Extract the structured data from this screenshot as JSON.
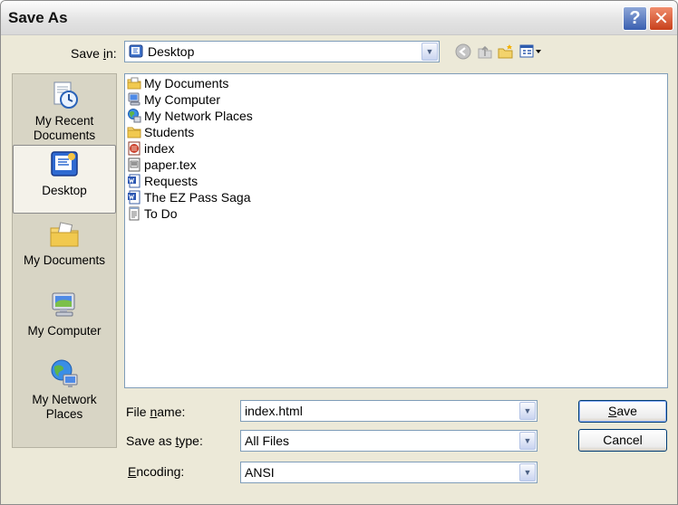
{
  "window": {
    "title": "Save As"
  },
  "titlebar": {
    "help_glyph": "?",
    "close_glyph": "✕"
  },
  "top": {
    "save_in_label_prefix": "Save ",
    "save_in_label_u": "i",
    "save_in_label_suffix": "n:",
    "save_in_value": "Desktop",
    "icons": [
      "back-icon",
      "up-folder-icon",
      "new-folder-icon",
      "view-menu-icon"
    ]
  },
  "places": [
    {
      "id": "recent",
      "label_line1": "My Recent",
      "label_line2": "Documents",
      "icon": "recent-documents-icon"
    },
    {
      "id": "desktop",
      "label_line1": "Desktop",
      "label_line2": "",
      "icon": "desktop-icon",
      "selected": true
    },
    {
      "id": "documents",
      "label_line1": "My Documents",
      "label_line2": "",
      "icon": "my-documents-icon"
    },
    {
      "id": "computer",
      "label_line1": "My Computer",
      "label_line2": "",
      "icon": "my-computer-icon"
    },
    {
      "id": "network",
      "label_line1": "My Network",
      "label_line2": "Places",
      "icon": "my-network-icon"
    }
  ],
  "files": [
    {
      "name": "My Documents",
      "icon": "my-documents-icon"
    },
    {
      "name": "My Computer",
      "icon": "my-computer-icon"
    },
    {
      "name": "My Network Places",
      "icon": "my-network-icon"
    },
    {
      "name": "Students",
      "icon": "folder-icon"
    },
    {
      "name": "index",
      "icon": "html-file-icon"
    },
    {
      "name": "paper.tex",
      "icon": "tex-file-icon"
    },
    {
      "name": "Requests",
      "icon": "word-document-icon"
    },
    {
      "name": "The EZ Pass Saga",
      "icon": "word-document-icon"
    },
    {
      "name": "To Do",
      "icon": "text-file-icon"
    }
  ],
  "form": {
    "file_name_label_prefix": "File ",
    "file_name_label_u": "n",
    "file_name_label_suffix": "ame:",
    "file_name_value": "index.html",
    "save_type_label_prefix": "Save as ",
    "save_type_label_u": "t",
    "save_type_label_suffix": "ype:",
    "save_type_value": "All Files",
    "encoding_label_prefix": "",
    "encoding_label_u": "E",
    "encoding_label_suffix": "ncoding:",
    "encoding_value": "ANSI"
  },
  "buttons": {
    "save_u": "S",
    "save_rest": "ave",
    "cancel": "Cancel"
  },
  "colors": {
    "dialog_bg": "#ece9d8",
    "accent_border": "#7f9db9",
    "close_red": "#c8401c",
    "help_blue": "#3a5fb0"
  }
}
